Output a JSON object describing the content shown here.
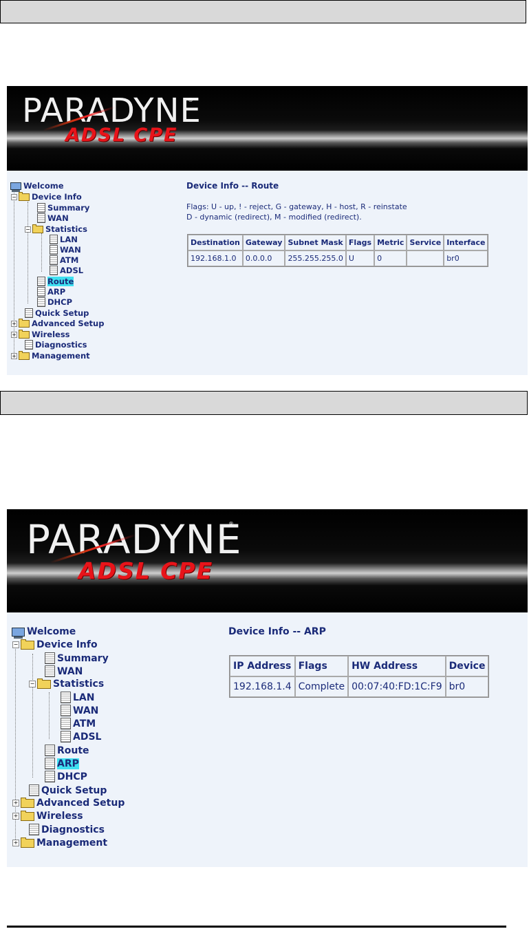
{
  "route_screen": {
    "logo_text": "PARADYNE",
    "logo_mark": "®",
    "product": "ADSL CPE",
    "nav": {
      "welcome": "Welcome",
      "device_info": "Device Info",
      "summary": "Summary",
      "wan": "WAN",
      "statistics": "Statistics",
      "lan": "LAN",
      "stats_wan": "WAN",
      "atm": "ATM",
      "adsl": "ADSL",
      "route": "Route",
      "arp": "ARP",
      "dhcp": "DHCP",
      "quick_setup": "Quick Setup",
      "advanced_setup": "Advanced Setup",
      "wireless": "Wireless",
      "diagnostics": "Diagnostics",
      "management": "Management",
      "selected": "route"
    },
    "title": "Device Info -- Route",
    "flags_line1": "Flags: U - up, ! - reject, G - gateway, H - host, R - reinstate",
    "flags_line2": "D - dynamic (redirect), M - modified (redirect).",
    "table": {
      "headers": [
        "Destination",
        "Gateway",
        "Subnet Mask",
        "Flags",
        "Metric",
        "Service",
        "Interface"
      ],
      "rows": [
        [
          "192.168.1.0",
          "0.0.0.0",
          "255.255.255.0",
          "U",
          "0",
          "",
          "br0"
        ]
      ]
    }
  },
  "arp_screen": {
    "logo_text": "PARADYNE",
    "logo_mark": "®",
    "product": "ADSL CPE",
    "nav": {
      "welcome": "Welcome",
      "device_info": "Device Info",
      "summary": "Summary",
      "wan": "WAN",
      "statistics": "Statistics",
      "lan": "LAN",
      "stats_wan": "WAN",
      "atm": "ATM",
      "adsl": "ADSL",
      "route": "Route",
      "arp": "ARP",
      "dhcp": "DHCP",
      "quick_setup": "Quick Setup",
      "advanced_setup": "Advanced Setup",
      "wireless": "Wireless",
      "diagnostics": "Diagnostics",
      "management": "Management",
      "selected": "arp"
    },
    "title": "Device Info -- ARP",
    "table": {
      "headers": [
        "IP Address",
        "Flags",
        "HW Address",
        "Device"
      ],
      "rows": [
        [
          "192.168.1.4",
          "Complete",
          "00:07:40:FD:1C:F9",
          "br0"
        ]
      ]
    }
  },
  "colors": {
    "nav_text": "#1a2a78",
    "selection": "#3fe0f0",
    "content_bg": "#eef3fa",
    "product_red": "#e8141a"
  }
}
